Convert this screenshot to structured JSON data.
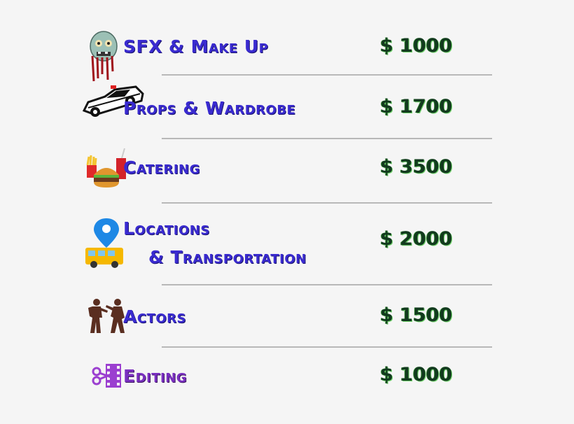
{
  "items": [
    {
      "label": "SFX & Make Up",
      "price": "$ 1000",
      "icon": "zombie-head-icon"
    },
    {
      "label": "Props & Wardrobe",
      "price": "$ 1700",
      "icon": "police-car-icon"
    },
    {
      "label": "Catering",
      "price": "$ 3500",
      "icon": "burger-fries-drink-icon"
    },
    {
      "label_line1": "Locations",
      "label_line2": "& Transportation",
      "price": "$ 2000",
      "icon": "location-pin-bus-icon"
    },
    {
      "label": "Actors",
      "price": "$ 1500",
      "icon": "zombie-silhouettes-icon"
    },
    {
      "label": "Editing",
      "price": "$ 1000",
      "icon": "scissors-film-icon"
    }
  ],
  "colors": {
    "label": "#3a2bd0",
    "editing_label": "#7a2fc0",
    "price": "#123a1e",
    "divider": "#b8b8b8",
    "background": "#f5f5f5"
  }
}
